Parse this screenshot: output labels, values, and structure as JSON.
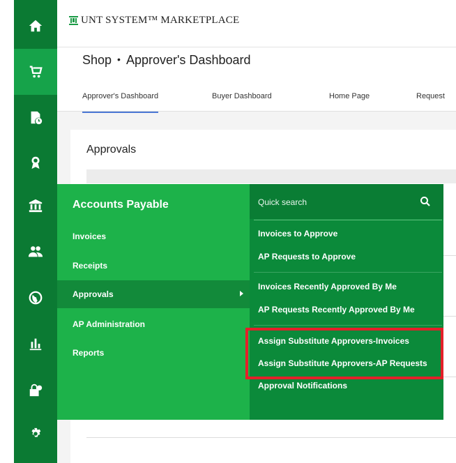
{
  "header": {
    "logo_text": "UNT SYSTEM™ MARKETPLACE"
  },
  "breadcrumb": {
    "section": "Shop",
    "page": "Approver's Dashboard"
  },
  "tabs": [
    {
      "label": "Approver's Dashboard",
      "active": true
    },
    {
      "label": "Buyer Dashboard",
      "active": false
    },
    {
      "label": "Home Page",
      "active": false
    },
    {
      "label": "Request",
      "active": false
    }
  ],
  "card": {
    "title": "Approvals"
  },
  "rail": {
    "items": [
      {
        "icon": "home-icon"
      },
      {
        "icon": "cart-icon"
      },
      {
        "icon": "document-clock-icon"
      },
      {
        "icon": "award-icon"
      },
      {
        "icon": "bank-icon"
      },
      {
        "icon": "people-icon"
      },
      {
        "icon": "globe-icon"
      },
      {
        "icon": "bar-chart-icon"
      },
      {
        "icon": "lock-gear-icon"
      },
      {
        "icon": "gear-icon"
      }
    ]
  },
  "flyout": {
    "title": "Accounts Payable",
    "items": [
      {
        "label": "Invoices",
        "selected": false
      },
      {
        "label": "Receipts",
        "selected": false
      },
      {
        "label": "Approvals",
        "selected": true
      },
      {
        "label": "AP Administration",
        "selected": false
      },
      {
        "label": "Reports",
        "selected": false
      }
    ],
    "quick_search_placeholder": "Quick search",
    "sub_items": [
      "Invoices to Approve",
      "AP Requests to Approve",
      "Invoices Recently Approved By Me",
      "AP Requests Recently Approved By Me",
      "Assign Substitute Approvers-Invoices",
      "Assign Substitute Approvers-AP Requests",
      "Approval Notifications"
    ]
  },
  "colors": {
    "rail": "#0b7a33",
    "flyout_primary": "#1db24a",
    "flyout_secondary": "#0b8a3a",
    "highlight": "#e3202a",
    "tab_active": "#4a77d4"
  }
}
